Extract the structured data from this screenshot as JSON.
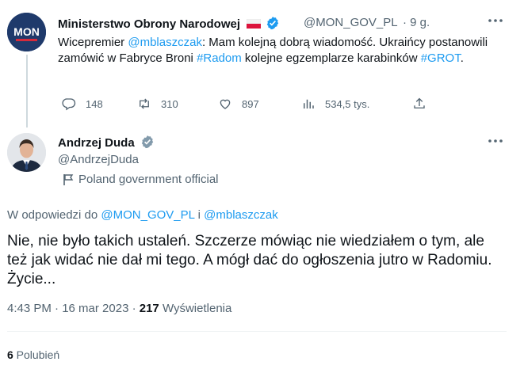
{
  "tweet1": {
    "author_name": "Ministerstwo Obrony Narodowej",
    "avatar_text": "MON",
    "handle": "@MON_GOV_PL",
    "time": "· 9 g.",
    "text_parts": [
      {
        "t": "Wicepremier ",
        "link": false
      },
      {
        "t": "@mblaszczak",
        "link": true
      },
      {
        "t": ": Mam kolejną dobrą wiadomość. Ukraińcy postanowili zamówić w Fabryce Broni ",
        "link": false
      },
      {
        "t": "#Radom",
        "link": true
      },
      {
        "t": " kolejne egzemplarze karabinków ",
        "link": false
      },
      {
        "t": "#GROT",
        "link": true
      },
      {
        "t": ".",
        "link": false
      }
    ],
    "replies": "148",
    "retweets": "310",
    "likes": "897",
    "views": "534,5 tys."
  },
  "tweet2": {
    "author_name": "Andrzej Duda",
    "handle": "@AndrzejDuda",
    "gov_label": "Poland government official",
    "reply_prefix": "W odpowiedzi do ",
    "reply_handle_1": "@MON_GOV_PL",
    "reply_and": " i ",
    "reply_handle_2": "@mblaszczak",
    "text": "Nie, nie było takich ustaleń. Szczerze mówiąc nie wiedziałem o tym, ale też jak widać nie dał mi tego. A mógł dać do ogłoszenia jutro w Radomiu. Życie...",
    "timestamp": "4:43 PM · 16 mar 2023 · ",
    "views_count": "217",
    "views_label": " Wyświetlenia",
    "likes_count": "6",
    "likes_label": " Polubień"
  },
  "colors": {
    "accent": "#1d9bf0",
    "muted": "#536471",
    "mon_navy": "#1f3a6b"
  },
  "icons": [
    "mon-logo",
    "poland-flag-icon",
    "verified-badge-icon",
    "grey-verified-badge-icon",
    "more-icon",
    "reply-icon",
    "retweet-icon",
    "like-icon",
    "views-icon",
    "share-icon",
    "government-flag-icon"
  ]
}
